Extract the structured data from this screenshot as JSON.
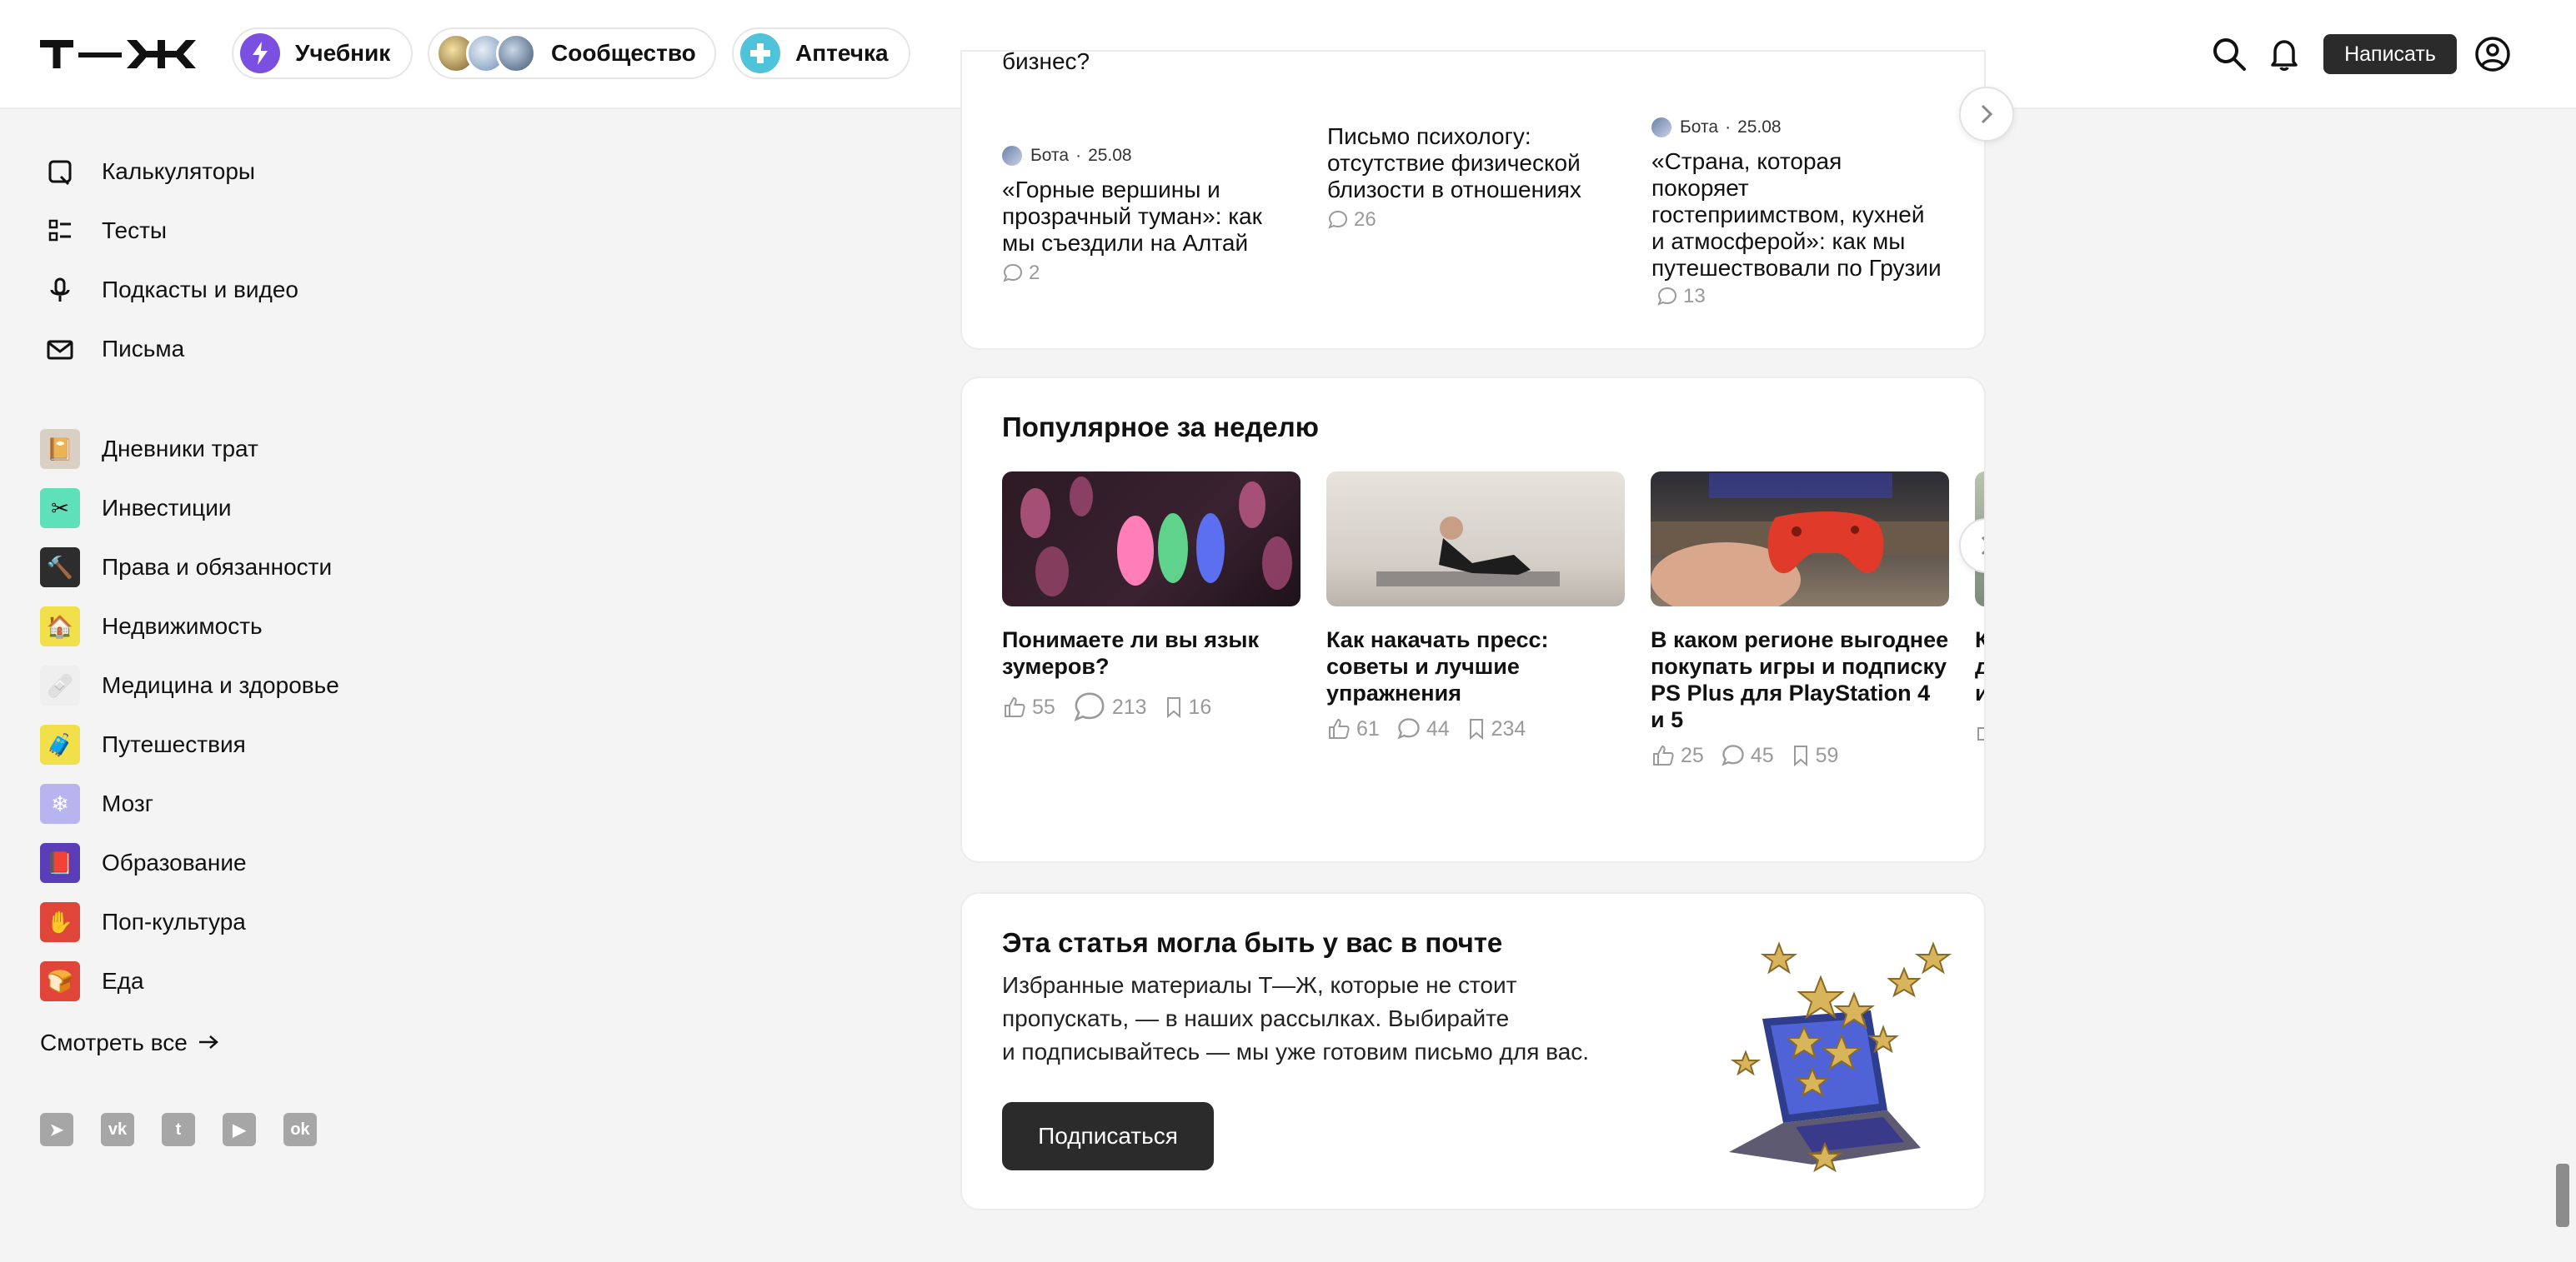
{
  "header": {
    "logo_alt": "Т—Ж",
    "pills": [
      {
        "label": "Учебник",
        "icon": "bolt-icon",
        "color": "#7b4fe0"
      },
      {
        "label": "Сообщество",
        "icon": "community-avatars"
      },
      {
        "label": "Аптечка",
        "icon": "plus-icon",
        "color": "#4fc3d9"
      }
    ],
    "write_label": "Написать"
  },
  "sidebar": {
    "tools": [
      {
        "label": "Калькуляторы",
        "icon": "calculator-icon"
      },
      {
        "label": "Тесты",
        "icon": "tests-icon"
      },
      {
        "label": "Подкасты и видео",
        "icon": "microphone-icon"
      },
      {
        "label": "Письма",
        "icon": "mail-icon"
      }
    ],
    "sections": [
      {
        "label": "Дневники трат",
        "icon": "diary-icon",
        "color": "#d9cfc2"
      },
      {
        "label": "Инвестиции",
        "icon": "investments-icon",
        "color": "#5ee0b8"
      },
      {
        "label": "Права и обязанности",
        "icon": "gavel-icon",
        "color": "#2d2d2d"
      },
      {
        "label": "Недвижимость",
        "icon": "house-icon",
        "color": "#f2e04a"
      },
      {
        "label": "Медицина и здоровье",
        "icon": "medicine-icon",
        "color": "#efefef"
      },
      {
        "label": "Путешествия",
        "icon": "suitcase-icon",
        "color": "#f2e04a"
      },
      {
        "label": "Мозг",
        "icon": "brain-icon",
        "color": "#b8b4ef"
      },
      {
        "label": "Образование",
        "icon": "education-icon",
        "color": "#5a3db8"
      },
      {
        "label": "Поп-культура",
        "icon": "popculture-icon",
        "color": "#e0453a"
      },
      {
        "label": "Еда",
        "icon": "food-icon",
        "color": "#e0453a"
      }
    ],
    "see_all": "Смотреть все",
    "socials": [
      "telegram-icon",
      "vk-icon",
      "twitter-icon",
      "youtube-icon",
      "ok-icon"
    ]
  },
  "top_strip": {
    "col1": {
      "cut_text": "бизнес?",
      "author": "Бота",
      "date": "25.08",
      "title": "«Горные вершины и прозрачный туман»: как мы съездили на Алтай",
      "comments": "2"
    },
    "col2": {
      "title": "Письмо психологу: отсутствие физической близости в отношениях",
      "comments": "26"
    },
    "col3": {
      "author": "Бота",
      "date": "25.08",
      "title": "«Страна, которая покоряет гостеприимством, кухней и атмосферой»: как мы путешествовали по Грузии",
      "comments": "13"
    }
  },
  "popular": {
    "title": "Популярное за неделю",
    "items": [
      {
        "title": "Понимаете ли вы язык зумеров?",
        "likes": "55",
        "comments": "213",
        "saves": "16"
      },
      {
        "title": "Как накачать пресс: советы и лучшие упражнения",
        "likes": "61",
        "comments": "44",
        "saves": "234"
      },
      {
        "title": "В каком регионе выгоднее покупать игры и подписку PS Plus для PlayStation 4 и 5",
        "likes": "25",
        "comments": "45",
        "saves": "59"
      },
      {
        "title": "К\nд\nи"
      }
    ]
  },
  "newsletter": {
    "title": "Эта статья могла быть у вас в почте",
    "text_line1": "Избранные материалы Т—Ж, которые не стоит",
    "text_line2": "пропускать, — в наших рассылках. Выбирайте",
    "text_line3": "и подписывайтесь — мы уже готовим письмо для вас.",
    "button": "Подписаться"
  }
}
